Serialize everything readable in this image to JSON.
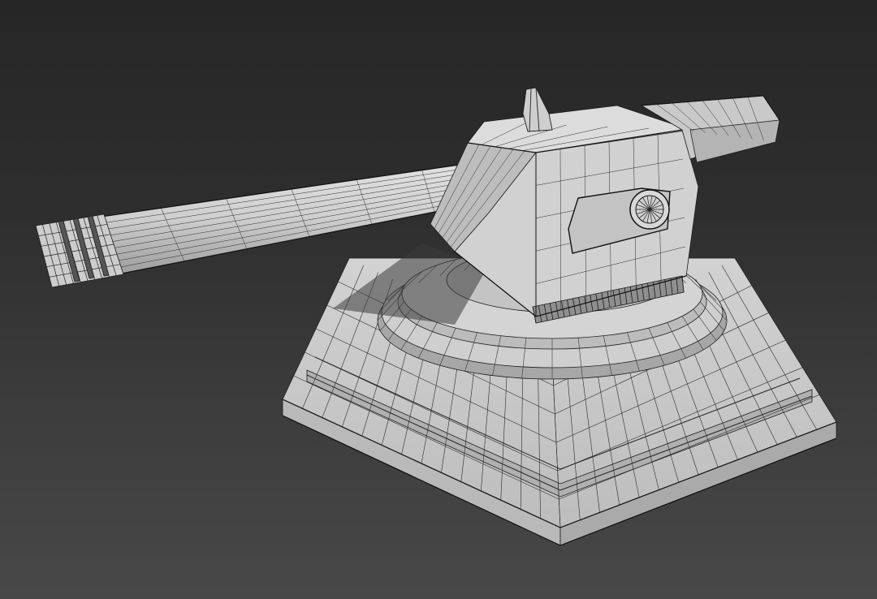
{
  "viewport": {
    "background_top": "#262626",
    "background_bottom": "#484848",
    "model_fill": "#c9c9c9",
    "model_fill_light": "#dedede",
    "model_fill_dark": "#9a9a9a",
    "wire_color": "#1c1c1c"
  },
  "model": {
    "name": "turret",
    "parts": [
      "pedestal-base",
      "turret-ring",
      "turret-housing",
      "gun-barrel",
      "muzzle",
      "rear-block",
      "sensor-fin",
      "side-vent"
    ]
  }
}
